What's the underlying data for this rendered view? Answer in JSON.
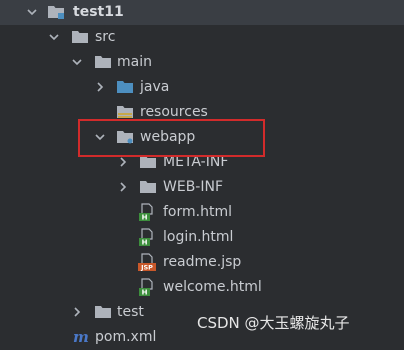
{
  "tree": {
    "project": "test11",
    "src": "src",
    "main": "main",
    "java": "java",
    "resources": "resources",
    "webapp": "webapp",
    "meta_inf": "META-INF",
    "web_inf": "WEB-INF",
    "form": "form.html",
    "login": "login.html",
    "readme": "readme.jsp",
    "welcome": "welcome.html",
    "test": "test",
    "pom": "pom.xml"
  },
  "badges": {
    "html": "H",
    "jsp": "JSP"
  },
  "colors": {
    "background": "#2b2d30",
    "folder": "#aeb3bb",
    "source_folder": "#4d8fc0",
    "html_badge": "#3d8f3d",
    "jsp_badge": "#c9582a",
    "highlight": "#d22b2b",
    "maven": "#4a78c8"
  },
  "watermark": "CSDN @大玉螺旋丸子"
}
